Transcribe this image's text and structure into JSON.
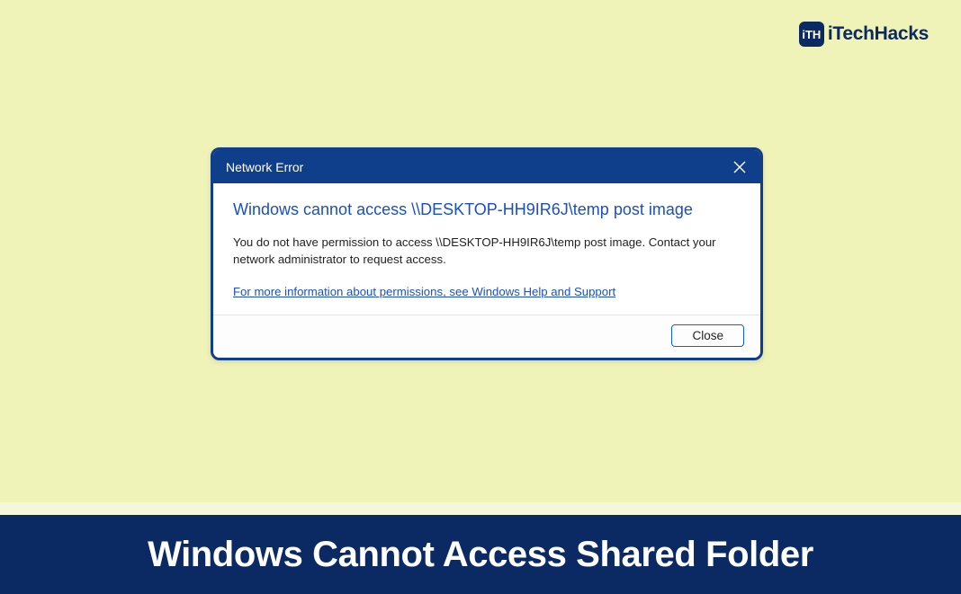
{
  "watermark": {
    "icon_text": "iTH",
    "label": "iTechHacks"
  },
  "dialog": {
    "title": "Network Error",
    "main_instruction": "Windows cannot access \\\\DESKTOP-HH9IR6J\\temp post image",
    "content": "You do not have permission to access \\\\DESKTOP-HH9IR6J\\temp post image. Contact your network administrator to request access.",
    "help_link": "For more information about permissions, see Windows Help and Support",
    "close_button": "Close"
  },
  "banner": {
    "text": "Windows Cannot Access Shared Folder"
  }
}
